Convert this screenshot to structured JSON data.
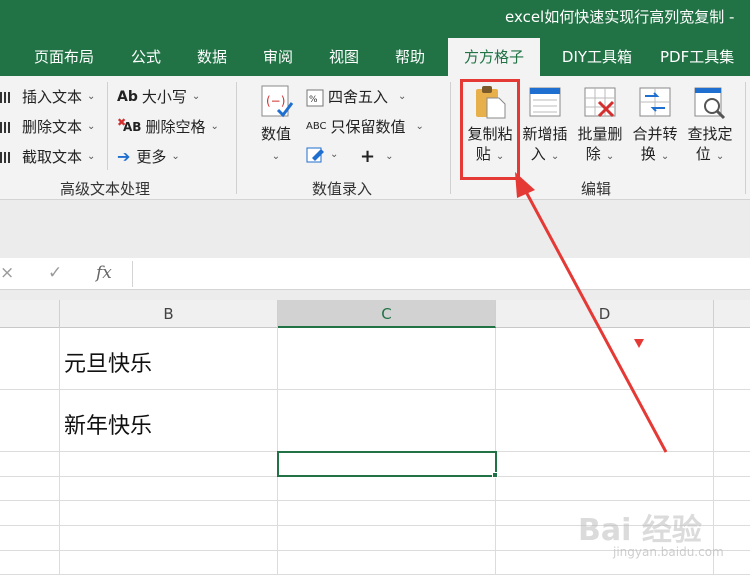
{
  "window": {
    "title": "excel如何快速实现行高列宽复制 - "
  },
  "tabs": [
    {
      "label": "页面布局"
    },
    {
      "label": "公式"
    },
    {
      "label": "数据"
    },
    {
      "label": "审阅"
    },
    {
      "label": "视图"
    },
    {
      "label": "帮助"
    },
    {
      "label": "方方格子",
      "active": true
    },
    {
      "label": "DIY工具箱"
    },
    {
      "label": "PDF工具集"
    }
  ],
  "ribbon": {
    "text_group": {
      "insert_text": "插入文本",
      "delete_text": "删除文本",
      "extract_text": "截取文本",
      "case": "大小写",
      "delete_spaces": "删除空格",
      "more": "更多",
      "case_icon_text": "Ab",
      "delete_space_icon_text": "AB",
      "label": "高级文本处理"
    },
    "number_group": {
      "number": "数值",
      "round": "四舍五入",
      "keep_numbers": "只保留数值",
      "keep_icon_text": "ABC",
      "plus": "+",
      "label": "数值录入"
    },
    "edit_group": {
      "copy_paste": [
        "复制粘",
        "贴"
      ],
      "new_insert": [
        "新增插",
        "入"
      ],
      "batch_delete": [
        "批量删",
        "除"
      ],
      "merge_convert": [
        "合并转",
        "换"
      ],
      "find_locate": [
        "查找定",
        "位"
      ],
      "label": "编辑"
    }
  },
  "formula_bar": {
    "cancel_icon": "×",
    "confirm_icon": "✓",
    "fx_icon": "fx",
    "value": ""
  },
  "grid": {
    "columns": [
      "B",
      "C",
      "D"
    ],
    "selected_column": "C",
    "cells": [
      {
        "ref": "B1",
        "value": "元旦快乐"
      },
      {
        "ref": "B2",
        "value": "新年快乐"
      }
    ],
    "selected_cell": "C3"
  },
  "annotation": {
    "highlight_color": "#e53935",
    "arrow_color": "#e53935"
  },
  "watermark": {
    "main": "Bai 经验",
    "sub": "jingyan.baidu.com"
  },
  "colors": {
    "excel_green": "#217346",
    "ribbon_bg": "#f3f3f3"
  }
}
